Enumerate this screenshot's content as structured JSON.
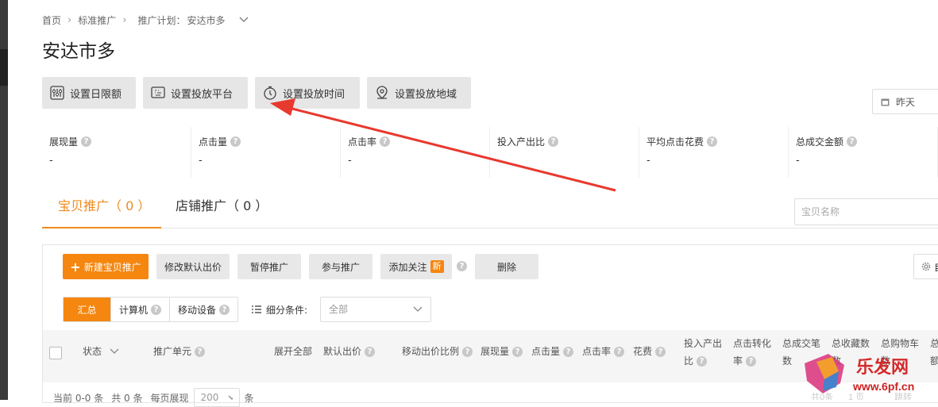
{
  "breadcrumb": {
    "items": [
      "首页",
      "标准推广"
    ],
    "plan_prefix": "推广计划：",
    "plan_name": "安达市多"
  },
  "page_title": "安达市多",
  "toolbar": {
    "daily_limit": "设置日限额",
    "platform": "设置投放平台",
    "time": "设置投放时间",
    "region": "设置投放地域"
  },
  "date_picker": {
    "value": "昨天"
  },
  "stats": [
    {
      "label": "展现量",
      "value": "-"
    },
    {
      "label": "点击量",
      "value": "-"
    },
    {
      "label": "点击率",
      "value": "-"
    },
    {
      "label": "投入产出比",
      "value": "-"
    },
    {
      "label": "平均点击花费",
      "value": "-"
    },
    {
      "label": "总成交金额",
      "value": "-"
    }
  ],
  "tabs": {
    "item_promo": "宝贝推广（ 0 ）",
    "shop_promo": "店铺推广（ 0 ）"
  },
  "search": {
    "placeholder": "宝贝名称"
  },
  "actions": {
    "new_item": "新建宝贝推广",
    "modify_bid": "修改默认出价",
    "pause": "暂停推广",
    "join": "参与推广",
    "add_follow": "添加关注",
    "new_badge": "新",
    "delete": "删除",
    "gear_label": "自"
  },
  "device_seg": {
    "summary": "汇总",
    "computer": "计算机",
    "mobile": "移动设备"
  },
  "filter": {
    "label": "细分条件:",
    "value": "全部"
  },
  "columns": {
    "status": "状态",
    "unit": "推广单元",
    "expand_all": "展开全部",
    "default_bid": "默认出价",
    "mobile_ratio": "移动出价比例",
    "impressions": "展现量",
    "clicks": "点击量",
    "ctr": "点击率",
    "cost": "花费",
    "roi_1": "投入产出",
    "roi_2": "比",
    "conv_1": "点击转化",
    "conv_2": "率",
    "deal_1": "总成交笔",
    "deal_2": "数",
    "fav_1": "总收藏数",
    "fav_2": "数",
    "cart_1": "总购物车",
    "cart_2": "数",
    "last_1": "总",
    "last_2": "额"
  },
  "footer": {
    "current": "当前 0-0 条",
    "total": "共 0 条",
    "per_page": "每页展现",
    "page_size": "200",
    "unit": "条"
  },
  "watermark": {
    "text": "乐发网",
    "url": "www.6pf.cn",
    "faded_1": "共0条",
    "faded_2": "1 页",
    "faded_3": "跳转"
  },
  "colors": {
    "accent": "#f5860f",
    "arrow": "#e8392f"
  }
}
